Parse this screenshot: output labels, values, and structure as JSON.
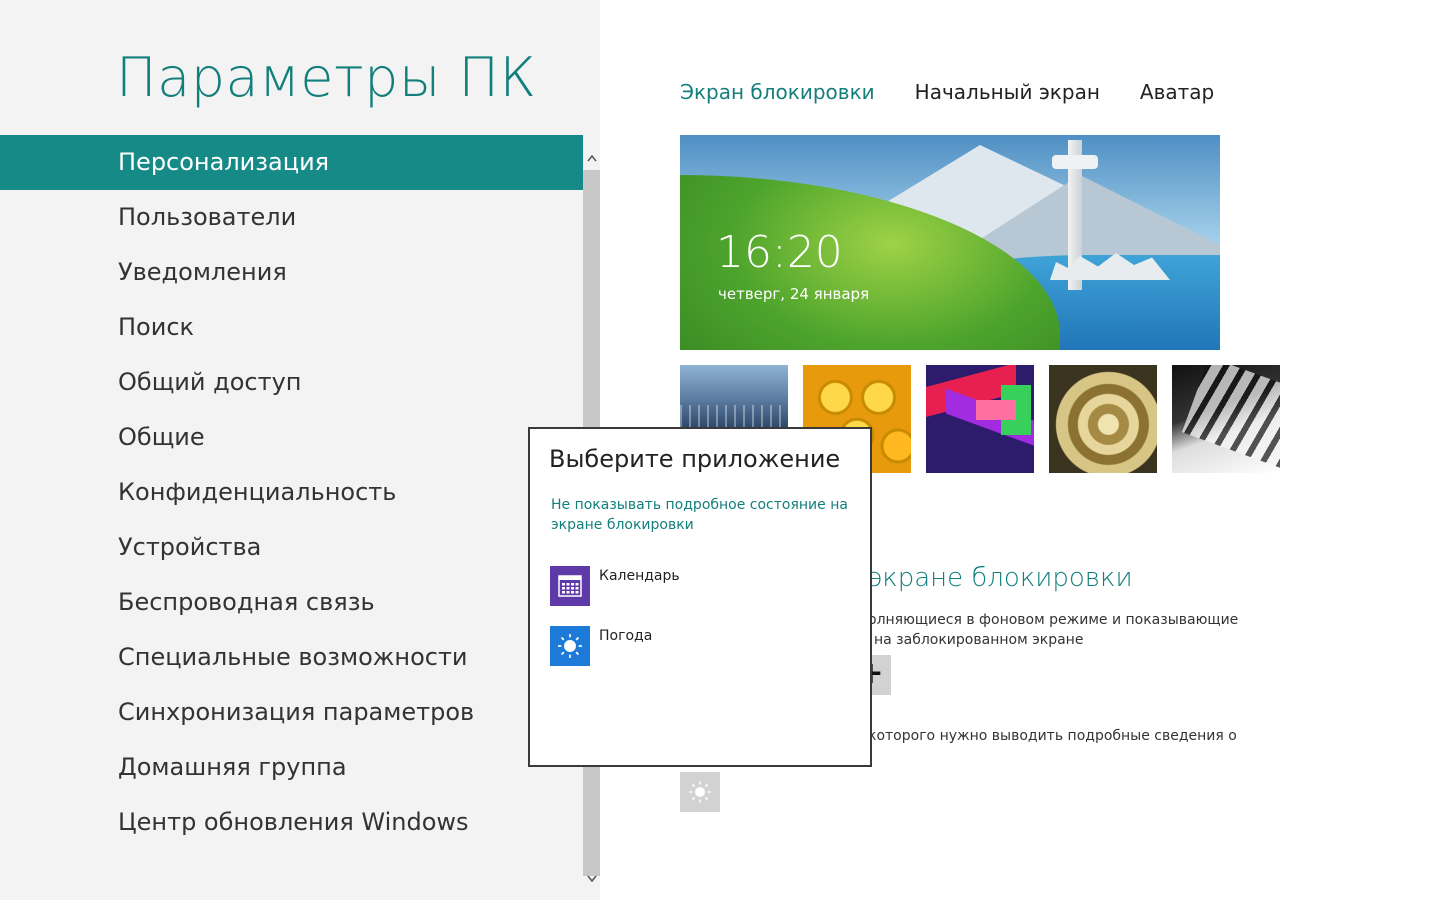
{
  "app": {
    "title": "Параметры ПК"
  },
  "nav": {
    "items": [
      {
        "label": "Персонализация",
        "selected": true
      },
      {
        "label": "Пользователи"
      },
      {
        "label": "Уведомления"
      },
      {
        "label": "Поиск"
      },
      {
        "label": "Общий доступ"
      },
      {
        "label": "Общие"
      },
      {
        "label": "Конфиденциальность"
      },
      {
        "label": "Устройства"
      },
      {
        "label": "Беспроводная связь"
      },
      {
        "label": "Специальные возможности"
      },
      {
        "label": "Синхронизация параметров"
      },
      {
        "label": "Домашняя группа"
      },
      {
        "label": "Центр обновления Windows"
      }
    ]
  },
  "tabs": [
    {
      "label": "Экран блокировки",
      "active": true
    },
    {
      "label": "Начальный экран"
    },
    {
      "label": "Аватар"
    }
  ],
  "lock_preview": {
    "time": "16:20",
    "date": "четверг, 24 января"
  },
  "thumbnails": [
    {
      "name": "thumb-light-tunnel"
    },
    {
      "name": "thumb-honeycomb"
    },
    {
      "name": "thumb-geometric"
    },
    {
      "name": "thumb-nautilus"
    },
    {
      "name": "thumb-piano"
    }
  ],
  "lock_apps": {
    "title": "экране блокировки",
    "desc_line1": "олняющиеся в фоновом режиме и показывающие",
    "desc_line2": "на заблокированном экране",
    "plus_symbol": "+",
    "detail_desc": "которого нужно выводить подробные сведения о"
  },
  "popup": {
    "title": "Выберите приложение",
    "link": "Не показывать подробное состояние на экране блокировки",
    "apps": [
      {
        "label": "Календарь",
        "icon": "calendar-icon"
      },
      {
        "label": "Погода",
        "icon": "sun-icon"
      }
    ]
  },
  "colors": {
    "accent": "#137f7c",
    "selected_bg": "#168a87",
    "left_bg": "#f3f3f3",
    "calendar_tile": "#5e3aa8",
    "weather_tile": "#1e7ad8",
    "slot_gray": "#d2d2d2"
  }
}
